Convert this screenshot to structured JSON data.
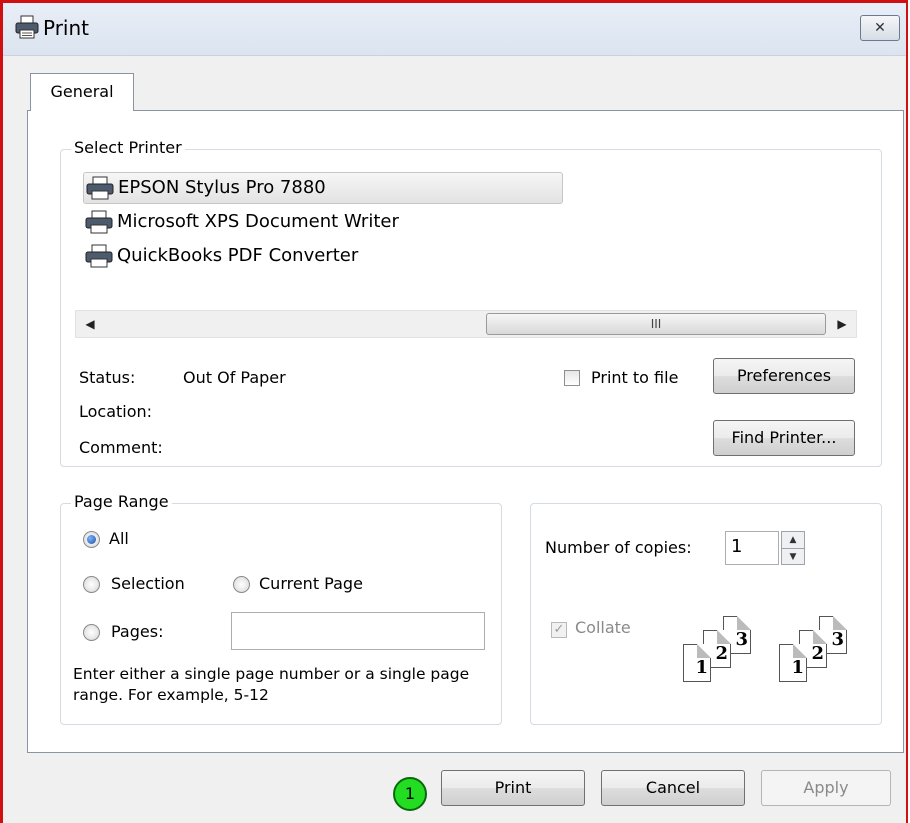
{
  "window": {
    "title": "Print",
    "close_label": "✕"
  },
  "tabs": [
    {
      "label": "General"
    }
  ],
  "select_printer": {
    "label": "Select Printer",
    "printers": [
      {
        "name": "EPSON Stylus Pro 7880",
        "selected": true
      },
      {
        "name": "Microsoft XPS Document Writer",
        "selected": false
      },
      {
        "name": "QuickBooks PDF Converter",
        "selected": false
      }
    ],
    "scroll_thumb_glyph": "III",
    "status_label": "Status:",
    "status_value": "Out Of Paper",
    "location_label": "Location:",
    "comment_label": "Comment:",
    "print_to_file_label": "Print to file",
    "preferences_label": "Preferences",
    "find_printer_label": "Find Printer..."
  },
  "page_range": {
    "label": "Page Range",
    "all_label": "All",
    "selection_label": "Selection",
    "current_page_label": "Current Page",
    "pages_label": "Pages:",
    "pages_value": "",
    "hint": "Enter either a single page number or a single page range.  For example, 5-12",
    "selected": "All"
  },
  "copies": {
    "label": "Number of copies:",
    "value": "1",
    "collate_label": "Collate",
    "collate_checked": true,
    "collate_icon_numbers": [
      "1",
      "2",
      "3"
    ]
  },
  "footer": {
    "print_label": "Print",
    "cancel_label": "Cancel",
    "apply_label": "Apply",
    "step_badge": "1"
  },
  "colors": {
    "frame": "#d01010",
    "badge": "#22dd22",
    "selection_radio": "#1a4fa3"
  }
}
